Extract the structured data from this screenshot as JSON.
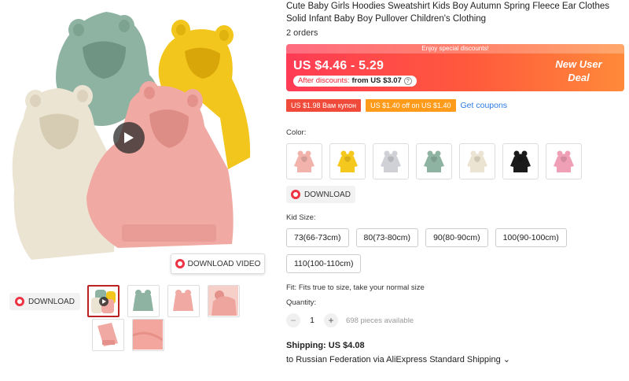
{
  "gallery": {
    "download_video_label": "DOWNLOAD VIDEO",
    "download_label": "DOWNLOAD",
    "hoodie_colors": {
      "mint": "#8fb3a3",
      "yellow": "#f2c61c",
      "cream": "#ece4d3",
      "pink": "#f0aaa3"
    }
  },
  "product": {
    "title": "Cute Baby Girls Hoodies Sweatshirt Kids Boy Autumn Spring Fleece Ear Clothes Solid Infant Baby Boy Pullover Children's Clothing",
    "orders": "2 orders"
  },
  "price_banner": {
    "top_text": "Enjoy special discounts!",
    "price": "US $4.46 - 5.29",
    "after_discount_prefix": "After discounts:",
    "after_discount_value": "from US $3.07",
    "new_user_line1": "New User",
    "new_user_line2": "Deal"
  },
  "coupons": {
    "coupon1": "US $1.98 Вам купон",
    "coupon2": "US $1.40 off on US $1.40",
    "get_coupons": "Get coupons"
  },
  "color": {
    "label": "Color:",
    "swatches": [
      "#f1b3ac",
      "#f5c81e",
      "#cfd1d6",
      "#8fb3a3",
      "#ece4d3",
      "#1b1b1b",
      "#ef9fb6"
    ],
    "download_label": "DOWNLOAD"
  },
  "size": {
    "label": "Kid Size:",
    "options": [
      "73(66-73cm)",
      "80(73-80cm)",
      "90(80-90cm)",
      "100(90-100cm)",
      "110(100-110cm)"
    ]
  },
  "fit": "Fit: Fits true to size, take your normal size",
  "quantity": {
    "label": "Quantity:",
    "value": "1",
    "minus": "−",
    "plus": "+",
    "available": "698 pieces available"
  },
  "shipping": {
    "line": "Shipping: US $4.08",
    "to": "to Russian Federation via AliExpress Standard Shipping ⌄"
  }
}
